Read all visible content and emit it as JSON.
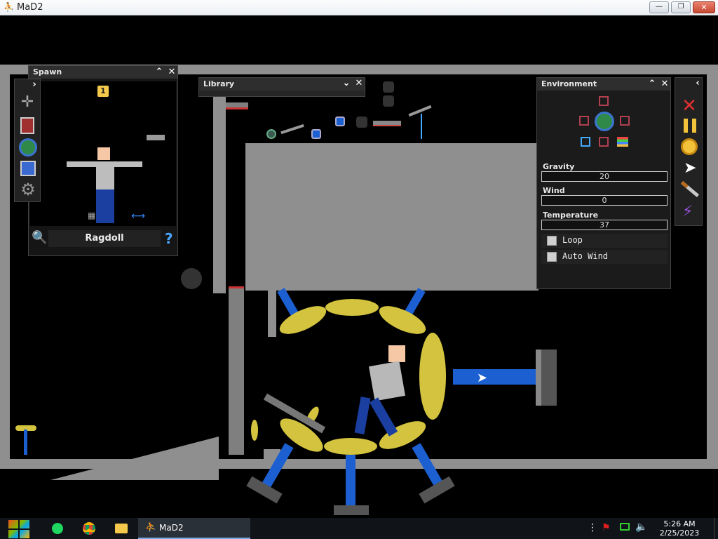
{
  "window": {
    "title": "MaD2",
    "minimize": "—",
    "maximize": "❐",
    "close": "✕"
  },
  "spawn_panel": {
    "title": "Spawn",
    "collapse": "⌃",
    "close": "✕",
    "expand_arrow": "›",
    "count_badge": "1",
    "selected_item": "Ragdoll",
    "search_icon": "search-icon",
    "help": "?"
  },
  "library_panel": {
    "title": "Library",
    "collapse": "⌄",
    "close": "✕"
  },
  "environment_panel": {
    "title": "Environment",
    "collapse": "⌃",
    "close": "✕",
    "gravity_label": "Gravity",
    "gravity_value": "20",
    "wind_label": "Wind",
    "wind_value": "0",
    "temperature_label": "Temperature",
    "temperature_value": "37",
    "loop_label": "Loop",
    "loop_checked": false,
    "auto_wind_label": "Auto Wind",
    "auto_wind_checked": false
  },
  "toolbar": {
    "collapse": "‹",
    "tools": [
      "delete-icon",
      "pause-icon",
      "stopwatch-icon",
      "pointer-icon",
      "knife-icon",
      "lightning-icon"
    ]
  },
  "taskbar": {
    "app_label": "MaD2",
    "time": "5:26 AM",
    "date": "2/25/2023"
  },
  "colors": {
    "accent_blue": "#1c5fd1",
    "wheel_yellow": "#d3c33e",
    "wall_gray": "#8f8f8f",
    "delete_red": "#e03030"
  }
}
